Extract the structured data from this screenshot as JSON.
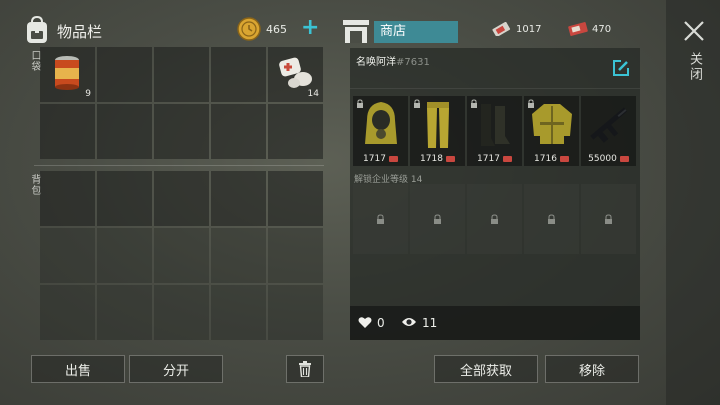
{
  "inventory": {
    "title": "物品栏",
    "coins": "465",
    "plus_icon": "plus-icon",
    "pocket_label": "口袋",
    "backpack_label": "背包",
    "pocket_items": [
      {
        "slot": 0,
        "icon": "canned-food-icon",
        "qty": "9"
      },
      {
        "slot": 4,
        "icon": "bandage-kit-icon",
        "qty": "14"
      }
    ],
    "sell_label": "出售",
    "split_label": "分开",
    "trash_icon": "trash-icon"
  },
  "shop": {
    "title": "商店",
    "currency_a": "1017",
    "currency_b": "470",
    "shop_name": "名唤阿洋",
    "shop_tag": "#7631",
    "items": [
      {
        "name": "hazmat-hood-icon",
        "price": "1717"
      },
      {
        "name": "hazmat-pants-icon",
        "price": "1718"
      },
      {
        "name": "rubber-boots-icon",
        "price": "1717"
      },
      {
        "name": "hazmat-jacket-icon",
        "price": "1716"
      },
      {
        "name": "assault-rifle-icon",
        "price": "55000"
      }
    ],
    "unlock_label": "解锁企业等级 14",
    "likes": "0",
    "views": "11",
    "collect_all_label": "全部获取",
    "remove_label": "移除"
  },
  "close_label": "关闭",
  "colors": {
    "accent": "#3e8a95",
    "plus": "#3bc3d4",
    "ticket": "#c9473f",
    "coin": "#d9a531"
  }
}
